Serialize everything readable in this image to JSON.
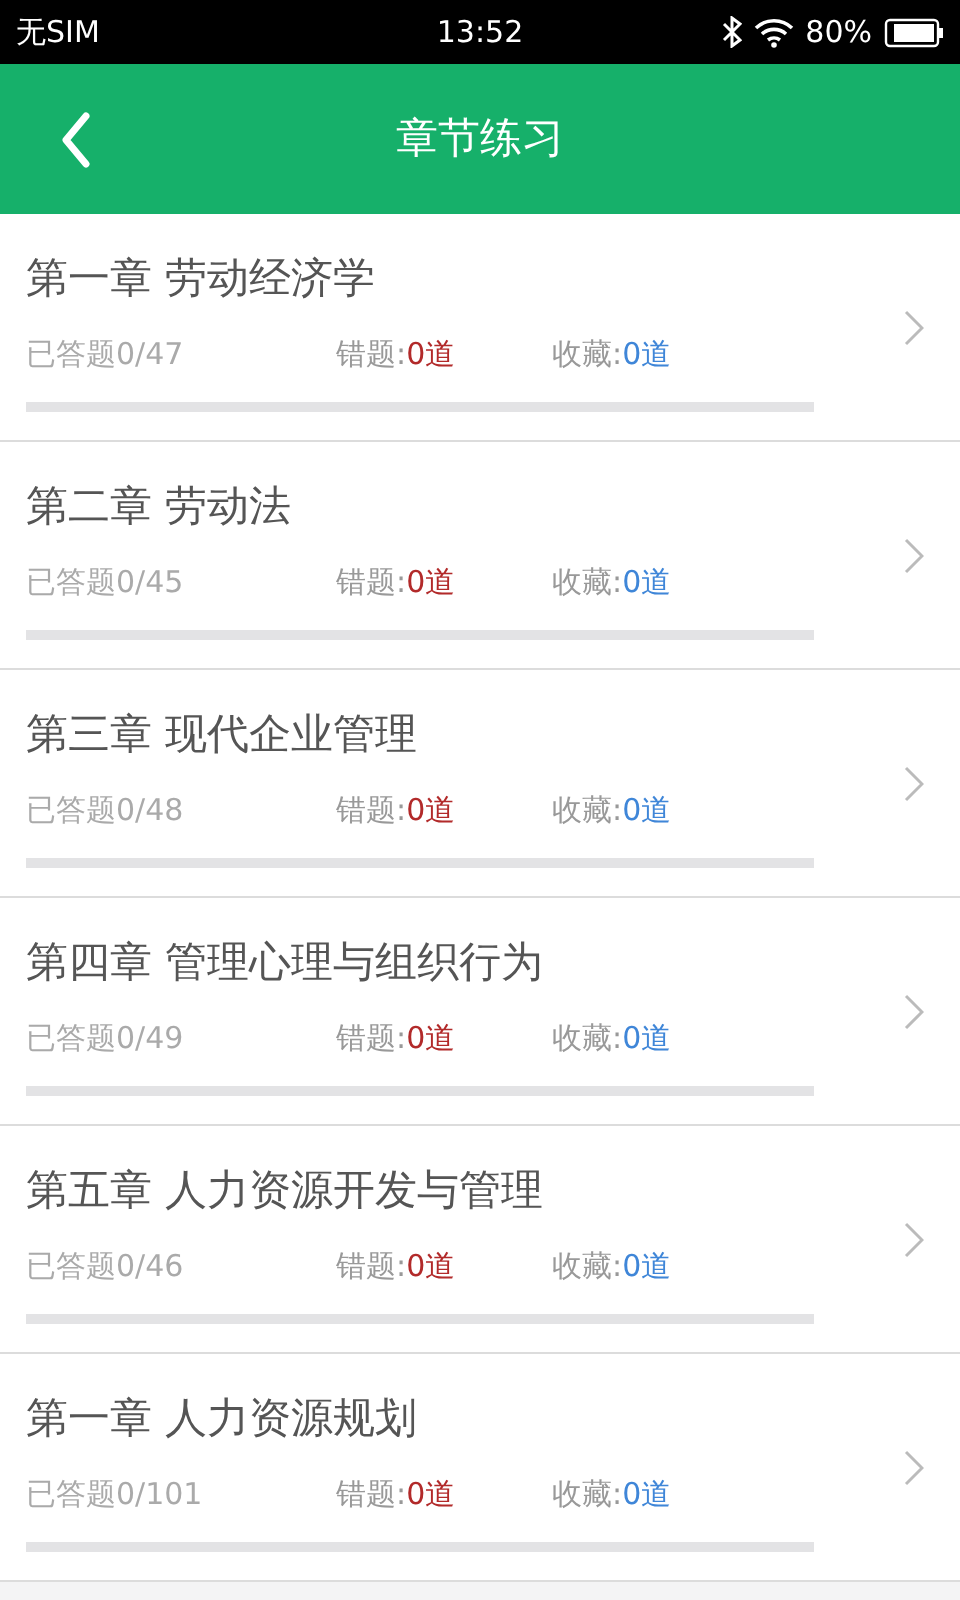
{
  "status_bar": {
    "carrier": "无SIM",
    "time": "13:52",
    "battery": "80%"
  },
  "header": {
    "title": "章节练习"
  },
  "chapters": [
    {
      "title": "第一章 劳动经济学",
      "answered": "已答题0/47",
      "wrong_label": "错题:",
      "wrong_count": "0道",
      "favorite_label": "收藏:",
      "favorite_count": "0道"
    },
    {
      "title": "第二章 劳动法",
      "answered": "已答题0/45",
      "wrong_label": "错题:",
      "wrong_count": "0道",
      "favorite_label": "收藏:",
      "favorite_count": "0道"
    },
    {
      "title": "第三章 现代企业管理",
      "answered": "已答题0/48",
      "wrong_label": "错题:",
      "wrong_count": "0道",
      "favorite_label": "收藏:",
      "favorite_count": "0道"
    },
    {
      "title": "第四章 管理心理与组织行为",
      "answered": "已答题0/49",
      "wrong_label": "错题:",
      "wrong_count": "0道",
      "favorite_label": "收藏:",
      "favorite_count": "0道"
    },
    {
      "title": "第五章 人力资源开发与管理",
      "answered": "已答题0/46",
      "wrong_label": "错题:",
      "wrong_count": "0道",
      "favorite_label": "收藏:",
      "favorite_count": "0道"
    },
    {
      "title": "第一章 人力资源规划",
      "answered": "已答题0/101",
      "wrong_label": "错题:",
      "wrong_count": "0道",
      "favorite_label": "收藏:",
      "favorite_count": "0道"
    }
  ]
}
